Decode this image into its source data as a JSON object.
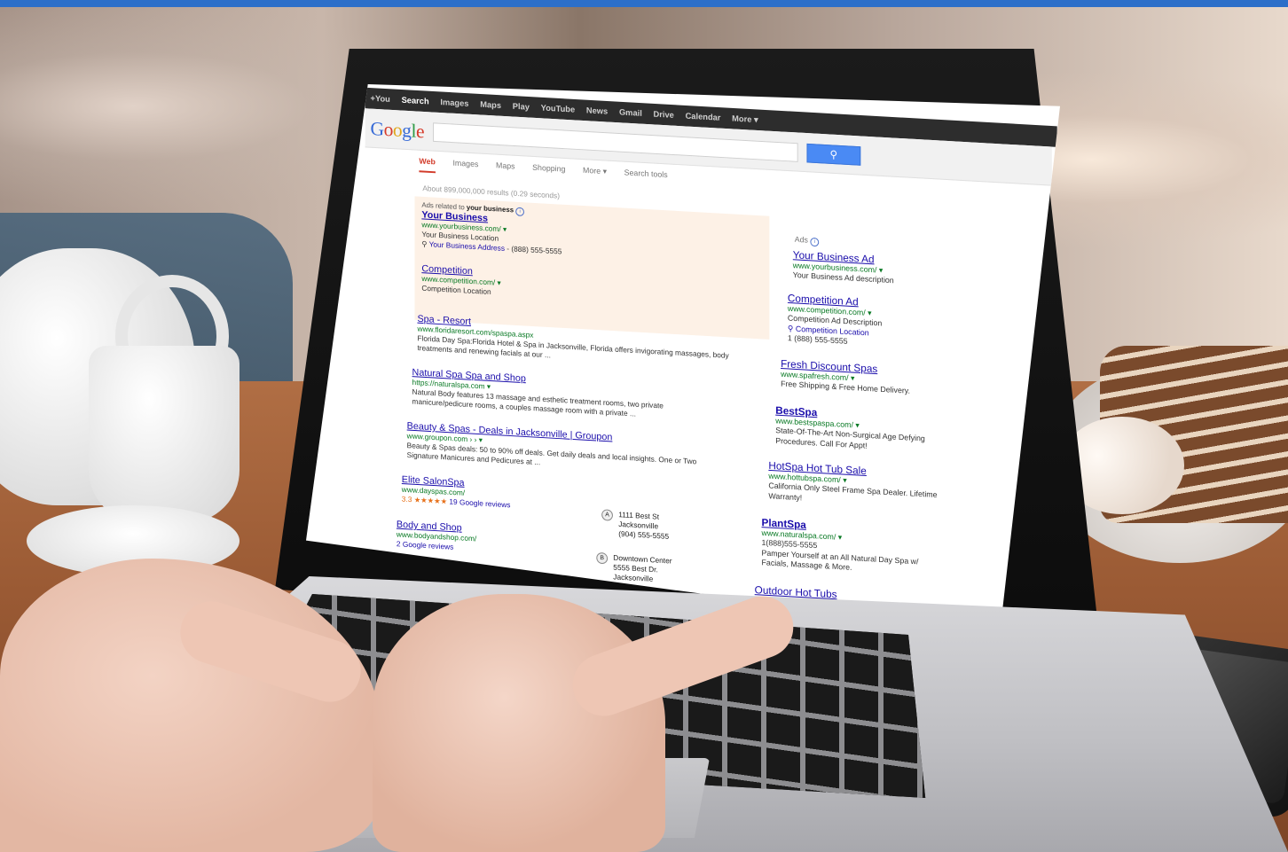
{
  "gbar": {
    "items": [
      "+You",
      "Search",
      "Images",
      "Maps",
      "Play",
      "YouTube",
      "News",
      "Gmail",
      "Drive",
      "Calendar",
      "More ▾"
    ],
    "active": "Search"
  },
  "logo": "Google",
  "search": {
    "value": "",
    "button_icon": "search-icon"
  },
  "tabs": [
    "Web",
    "Images",
    "Maps",
    "Shopping",
    "More ▾",
    "Search tools"
  ],
  "stats": "About 899,000,000 results (0.29 seconds)",
  "ads_top": {
    "header_prefix": "Ads related to ",
    "header_bold": "your business",
    "items": [
      {
        "title": "Your Business",
        "url": "www.yourbusiness.com/ ▾",
        "line1": "Your Business Location",
        "address": "Your Business Address",
        "phone": " - (888) 555-5555"
      },
      {
        "title": "Competition",
        "url": "www.competition.com/ ▾",
        "line1": "Competition Location"
      }
    ]
  },
  "organic": [
    {
      "title": "Spa - Resort",
      "url": "www.floridaresort.com/spaspa.aspx",
      "desc": "Florida Day Spa:Florida Hotel & Spa in Jacksonville, Florida offers invigorating massages, body treatments and renewing facials at our ..."
    },
    {
      "title": "Natural Spa Spa and Shop",
      "url": "https://naturalspa.com ▾",
      "desc": "Natural Body features 13 massage and esthetic treatment rooms, two private manicure/pedicure rooms, a couples massage room with a private ..."
    },
    {
      "title": "Beauty & Spas - Deals in Jacksonville | Groupon",
      "url": "www.groupon.com › › ▾",
      "desc": "Beauty & Spas deals: 50 to 90% off deals. Get daily deals and local insights. One or Two Signature Manicures and Pedicures at ..."
    },
    {
      "title": "Elite SalonSpa",
      "url": "www.dayspas.com/",
      "rating": "3.3",
      "stars": "★★★★★",
      "reviews": "19 Google reviews"
    },
    {
      "title": "Body and Shop",
      "url": "www.bodyandshop.com/",
      "reviews": "2 Google reviews"
    }
  ],
  "map_pins": [
    {
      "letter": "A",
      "lines": [
        "1111 Best St",
        "Jacksonville",
        "(904) 555-5555"
      ]
    },
    {
      "letter": "B",
      "lines": [
        "Downtown Center",
        "5555 Best Dr.",
        "Jacksonville"
      ]
    }
  ],
  "side_ads": {
    "header": "Ads",
    "items": [
      {
        "title": "Your Business Ad",
        "url": "www.yourbusiness.com/ ▾",
        "desc": "Your Business Ad description"
      },
      {
        "title": "Competition Ad",
        "url": "www.competition.com/ ▾",
        "desc": "Competition Ad Description",
        "address": "Competition Location",
        "phone": "1 (888) 555-5555"
      },
      {
        "title": "Fresh Discount Spas",
        "url": "www.spafresh.com/ ▾",
        "desc": "Free Shipping & Free Home Delivery."
      },
      {
        "title": "BestSpa",
        "url": "www.bestspaspa.com/ ▾",
        "desc": "State-Of-The-Art Non-Surgical Age Defying Procedures. Call For Appt!"
      },
      {
        "title": "HotSpa Hot Tub Sale",
        "url": "www.hottubspa.com/ ▾",
        "desc": "California Only Steel Frame Spa Dealer. Lifetime Warranty!"
      },
      {
        "title": "PlantSpa",
        "url": "www.naturalspa.com/ ▾",
        "phone": "1(888)555-5555",
        "desc": "Pamper Yourself at an All Natural Day Spa w/ Facials, Massage & More."
      },
      {
        "title": "Outdoor Hot Tubs"
      }
    ]
  },
  "colors": {
    "accent_bar": "#2c6fc9",
    "link": "#1a0dab",
    "url": "#0a7a25",
    "ad_bg": "#fdf1e6"
  }
}
